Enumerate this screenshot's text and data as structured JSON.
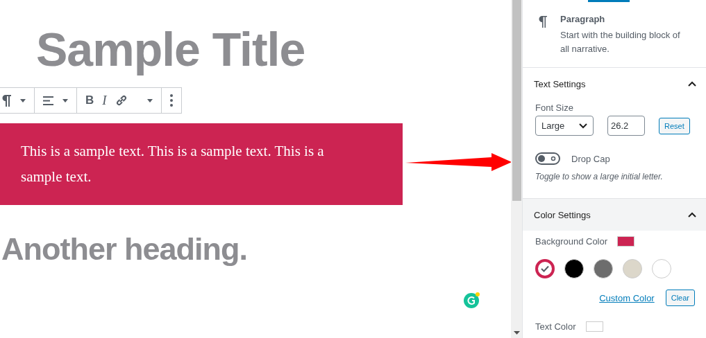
{
  "editor": {
    "title": "Sample Title",
    "toolbar": [
      {
        "kind": "paragraph"
      },
      {
        "kind": "align"
      },
      {
        "kind": "bold",
        "label": "B"
      },
      {
        "kind": "italic",
        "label": "I"
      },
      {
        "kind": "link"
      },
      {
        "kind": "more"
      }
    ],
    "paragraph": {
      "text": "This is a sample text. This is a sample text. This is a sample text."
    },
    "heading": "Another heading."
  },
  "sidebar": {
    "block": {
      "name": "Paragraph",
      "description": "Start with the building block of all narrative."
    },
    "text_settings": {
      "title": "Text Settings",
      "expanded": true,
      "font_size_label": "Font Size",
      "font_size": "Large",
      "custom_size": "26.2",
      "reset": "Reset",
      "drop_cap": {
        "label": "Drop Cap",
        "on": false
      },
      "help": "Toggle to show a large initial letter."
    },
    "color_settings": {
      "title": "Color Settings",
      "expanded": true,
      "background_label": "Background Color",
      "swatches": [
        {
          "color": "#cc2452",
          "selected": true
        },
        {
          "color": "#000000",
          "selected": false
        },
        {
          "color": "#6d6d6d",
          "selected": false
        },
        {
          "color": "#dcd7ca",
          "selected": false
        },
        {
          "color": "#ffffff",
          "selected": false
        }
      ],
      "custom_color": "Custom Color",
      "clear": "Clear",
      "text_label": "Text Color"
    }
  }
}
